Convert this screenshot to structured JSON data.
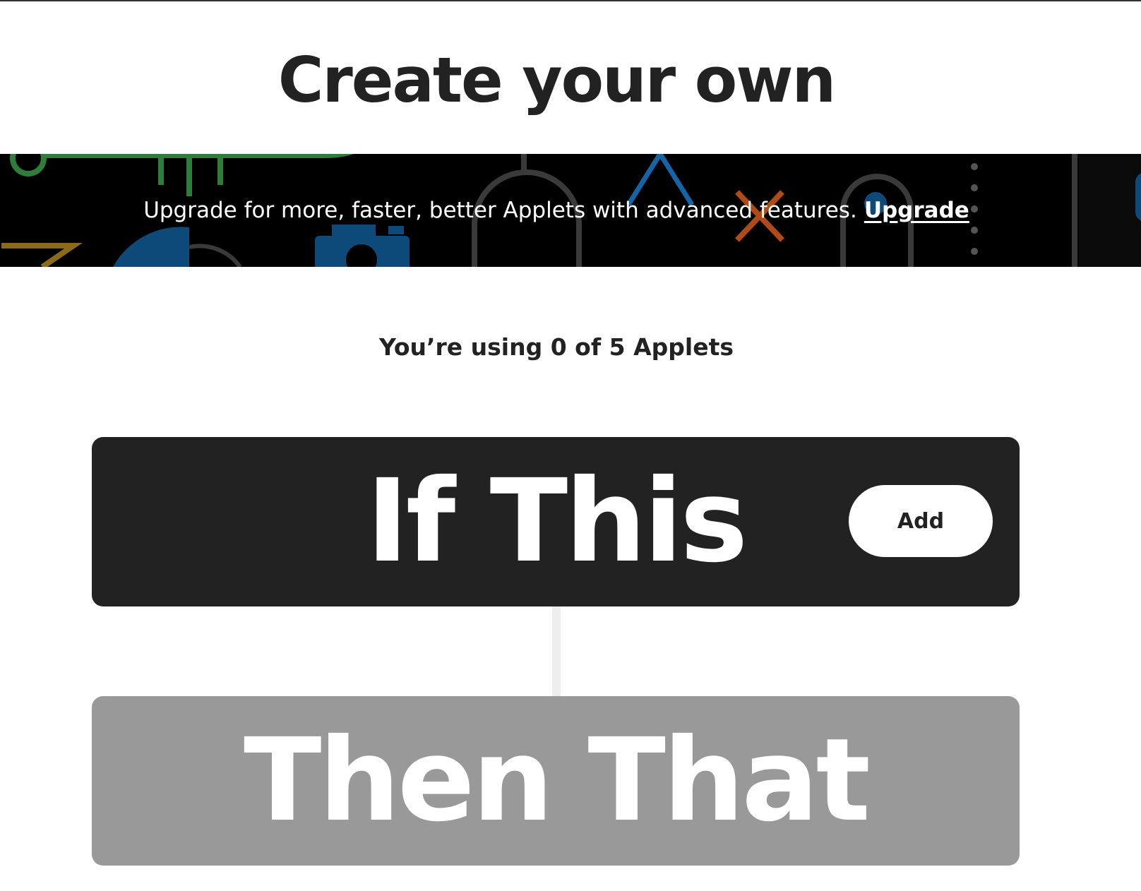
{
  "page": {
    "title": "Create your own",
    "background": "#ffffff"
  },
  "banner": {
    "message": "Upgrade for more, faster, better Applets with advanced features.",
    "link_label": "Upgrade",
    "background": "#000000",
    "decoration_colors": [
      "#2e7d3a",
      "#1565a6",
      "#8b5a1a",
      "#b04a16",
      "#3a3a3a"
    ]
  },
  "usage": {
    "text": "You’re using 0 of 5 Applets"
  },
  "trigger": {
    "label": "If This",
    "add_label": "Add",
    "background": "#222222"
  },
  "action": {
    "label": "Then That",
    "background": "#999999"
  }
}
